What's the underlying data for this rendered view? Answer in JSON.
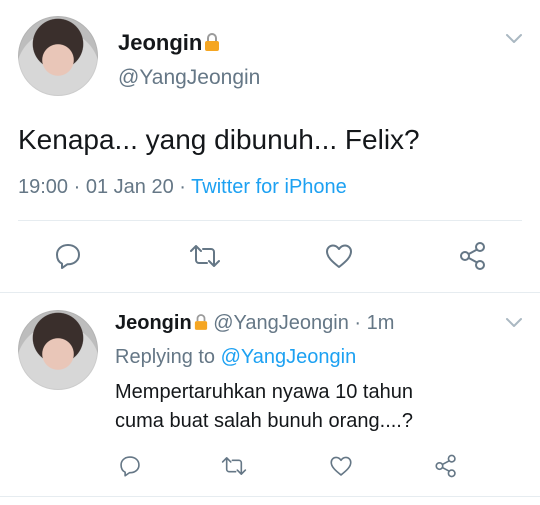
{
  "main_tweet": {
    "display_name": "Jeongin",
    "handle": "@YangJeongin",
    "text": "Kenapa... yang dibunuh... Felix?",
    "time": "19:00",
    "separator1": "·",
    "date": "01 Jan 20",
    "separator2": "·",
    "source": "Twitter for iPhone"
  },
  "reply": {
    "display_name": "Jeongin",
    "handle": "@YangJeongin",
    "separator": "·",
    "age": "1m",
    "replying_prefix": "Replying to",
    "replying_to": "@YangJeongin",
    "text_line1": "Mempertaruhkan nyawa 10 tahun",
    "text_line2": "cuma buat salah bunuh orang....?"
  },
  "icons": {
    "reply": "reply-icon",
    "retweet": "retweet-icon",
    "like": "like-icon",
    "share": "share-icon",
    "lock": "lock-icon",
    "more": "chevron-down-icon"
  },
  "colors": {
    "link": "#1da1f2",
    "muted": "#657786",
    "lock": "#f5a623"
  }
}
